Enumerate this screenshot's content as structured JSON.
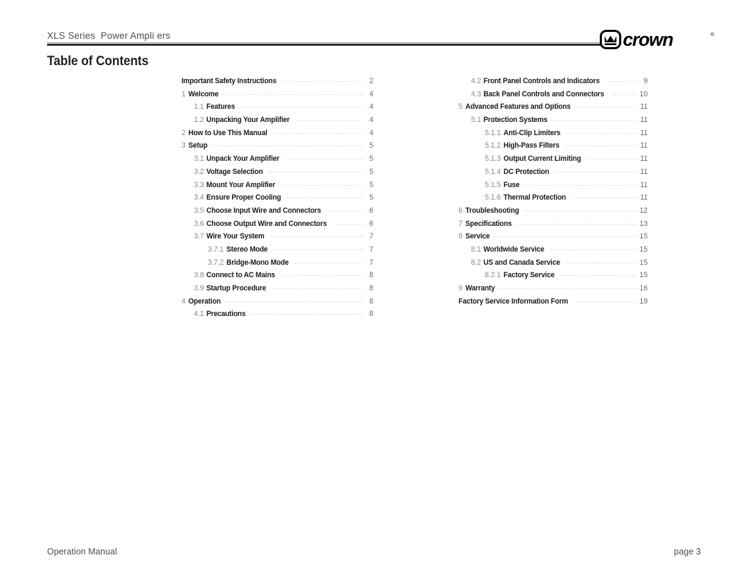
{
  "header": {
    "title": "XLS Series  Power Ampli ers",
    "logo_wordmark": "crown",
    "logo_trademark": "®"
  },
  "page_title": "Table of Contents",
  "footer": {
    "left": "Operation Manual",
    "right": "page 3"
  },
  "toc": {
    "left_column": [
      {
        "num": "",
        "label": "Important Safety Instructions",
        "page": "2",
        "level": 1
      },
      {
        "num": "1",
        "label": "Welcome",
        "page": "4",
        "level": 1
      },
      {
        "num": "1.1",
        "label": "Features",
        "page": "4",
        "level": 2
      },
      {
        "num": "1.2",
        "label": "Unpacking Your Amplifier",
        "page": "4",
        "level": 2
      },
      {
        "num": "2",
        "label": "How to Use This Manual",
        "page": "4",
        "level": 1
      },
      {
        "num": "3",
        "label": "Setup",
        "page": "5",
        "level": 1
      },
      {
        "num": "3.1",
        "label": "Unpack Your Amplifier",
        "page": "5",
        "level": 2
      },
      {
        "num": "3.2",
        "label": "Voltage Selection",
        "page": "5",
        "level": 2
      },
      {
        "num": "3.3",
        "label": "Mount Your Amplifier",
        "page": "5",
        "level": 2
      },
      {
        "num": "3.4",
        "label": "Ensure Proper Cooling",
        "page": "5",
        "level": 2
      },
      {
        "num": "3.5",
        "label": "Choose Input Wire and Connectors",
        "page": "6",
        "level": 2
      },
      {
        "num": "3.6",
        "label": "Choose Output Wire and Connectors",
        "page": "6",
        "level": 2
      },
      {
        "num": "3.7",
        "label": "Wire Your System",
        "page": "7",
        "level": 2
      },
      {
        "num": "3.7.1",
        "label": "Stereo Mode",
        "page": "7",
        "level": 3
      },
      {
        "num": "3.7.2",
        "label": "Bridge-Mono Mode",
        "page": "7",
        "level": 3
      },
      {
        "num": "3.8",
        "label": "Connect to AC Mains",
        "page": "8",
        "level": 2
      },
      {
        "num": "3.9",
        "label": "Startup Procedure",
        "page": "8",
        "level": 2
      },
      {
        "num": "4",
        "label": "Operation",
        "page": "8",
        "level": 1
      },
      {
        "num": "4.1",
        "label": "Precautions",
        "page": "8",
        "level": 2
      }
    ],
    "right_column": [
      {
        "num": "4.2",
        "label": "Front Panel Controls and Indicators",
        "page": "9",
        "level": 2
      },
      {
        "num": "4.3",
        "label": "Back Panel Controls and Connectors",
        "page": "10",
        "level": 2
      },
      {
        "num": "5",
        "label": "Advanced Features and Options",
        "page": "11",
        "level": 1
      },
      {
        "num": "5.1",
        "label": "Protection Systems",
        "page": "11",
        "level": 2
      },
      {
        "num": "5.1.1",
        "label": "Anti-Clip Limiters",
        "page": "11",
        "level": 3
      },
      {
        "num": "5.1.2",
        "label": "High-Pass Filters",
        "page": "11",
        "level": 3
      },
      {
        "num": "5.1.3",
        "label": "Output Current Limiting",
        "page": "11",
        "level": 3
      },
      {
        "num": "5.1.4",
        "label": "DC Protection",
        "page": "11",
        "level": 3
      },
      {
        "num": "5.1.5",
        "label": "Fuse",
        "page": "11",
        "level": 3
      },
      {
        "num": "5.1.6",
        "label": "Thermal Protection",
        "page": "11",
        "level": 3
      },
      {
        "num": "6",
        "label": "Troubleshooting",
        "page": "12",
        "level": 1
      },
      {
        "num": "7",
        "label": "Specifications",
        "page": "13",
        "level": 1
      },
      {
        "num": "8",
        "label": "Service",
        "page": "15",
        "level": 1
      },
      {
        "num": "8.1",
        "label": "Worldwide Service",
        "page": "15",
        "level": 2
      },
      {
        "num": "8.2",
        "label": "US and Canada Service",
        "page": "15",
        "level": 2
      },
      {
        "num": "8.2.1",
        "label": "Factory Service",
        "page": "15",
        "level": 3
      },
      {
        "num": "9",
        "label": "Warranty",
        "page": "16",
        "level": 1
      },
      {
        "num": "",
        "label": "Factory Service Information Form",
        "page": "19",
        "level": 1
      }
    ]
  },
  "colors": {
    "text": "#1a1a1a",
    "number_gray": "#8a8a8a",
    "leader_gray": "#b0b0b0",
    "rule_dark": "#2b2b2b",
    "rule_light": "#9a9a9a"
  }
}
